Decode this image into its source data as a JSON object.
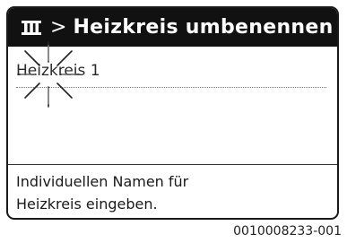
{
  "header": {
    "icon": "heating-circuit-icon",
    "separator": ">",
    "title": "Heizkreis umbenennen"
  },
  "field": {
    "value": "Heizkreis 1",
    "highlight": "press-indicator"
  },
  "help_text": {
    "line1": "Individuellen Namen für",
    "line2": "Heizkreis eingeben."
  },
  "caption": "0010008233-001",
  "colors": {
    "header_bg": "#111111",
    "header_text": "#ffffff"
  }
}
